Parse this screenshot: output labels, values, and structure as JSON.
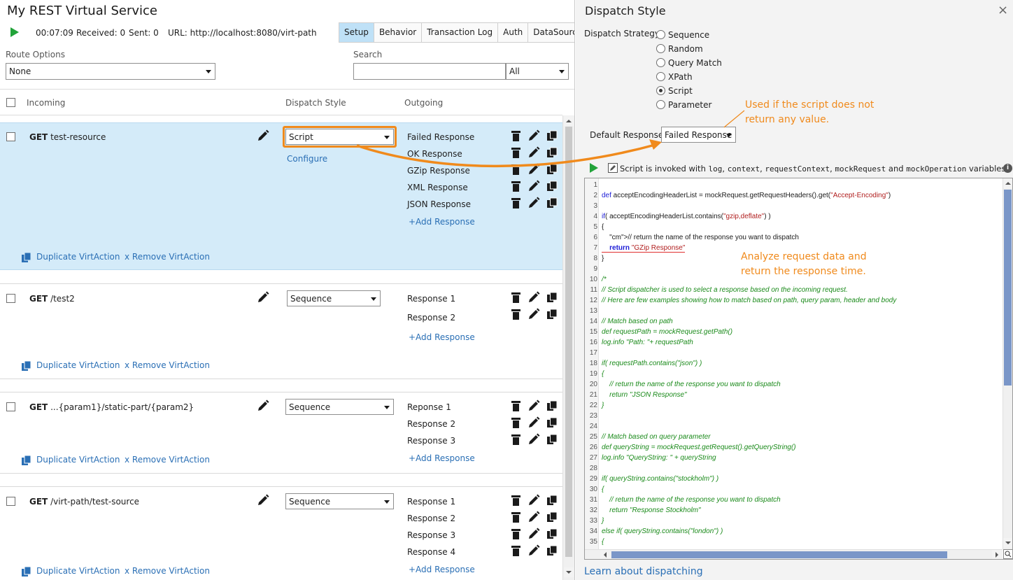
{
  "left": {
    "title": "My REST Virtual Service",
    "status": {
      "elapsed": "00:07:09",
      "received": "Received: 0",
      "sent": "Sent: 0",
      "url": "URL: http://localhost:8080/virt-path"
    },
    "tabs": [
      "Setup",
      "Behavior",
      "Transaction Log",
      "Auth",
      "DataSources"
    ],
    "active_tab": "Setup",
    "route_options_label": "Route Options",
    "route_options_value": "None",
    "search_label": "Search",
    "search_value": "",
    "search_filter": "All",
    "columns": {
      "incoming": "Incoming",
      "dispatch": "Dispatch Style",
      "outgoing": "Outgoing"
    },
    "routes": [
      {
        "method": "GET",
        "path": "test-resource",
        "dispatch": "Script",
        "configure": "Configure",
        "responses": [
          "Failed Response",
          "OK Response",
          "GZip Response",
          "XML Response",
          "JSON Response"
        ],
        "add_response": "+Add Response",
        "duplicate": "Duplicate VirtAction",
        "remove": "x Remove VirtAction"
      },
      {
        "method": "GET",
        "path": "/test2",
        "dispatch": "Sequence",
        "responses": [
          "Response 1",
          "Response 2"
        ],
        "add_response": "+Add Response",
        "duplicate": "Duplicate VirtAction",
        "remove": "x Remove VirtAction"
      },
      {
        "method": "GET",
        "path": "...{param1}/static-part/{param2}",
        "dispatch": "Sequence",
        "responses": [
          "Reponse 1",
          "Response 2",
          "Response 3"
        ],
        "add_response": "+Add Response",
        "duplicate": "Duplicate VirtAction",
        "remove": "x Remove VirtAction"
      },
      {
        "method": "GET",
        "path": "/virt-path/test-source",
        "dispatch": "Sequence",
        "responses": [
          "Response 1",
          "Response 2",
          "Response 3",
          "Response 4"
        ],
        "add_response": "+Add Response",
        "duplicate": "Duplicate VirtAction",
        "remove": "x Remove VirtAction"
      }
    ]
  },
  "right": {
    "title": "Dispatch Style",
    "close": "×",
    "strategy_label": "Dispatch Strategy:",
    "strategies": [
      "Sequence",
      "Random",
      "Query Match",
      "XPath",
      "Script",
      "Parameter"
    ],
    "selected_strategy": "Script",
    "default_response_label": "Default Response:",
    "default_response_value": "Failed Response",
    "annotation_default": [
      "Used if the script does not",
      "return any value."
    ],
    "annotation_analyze": [
      "Analyze request data and",
      "return the response time."
    ],
    "script_info": {
      "prefix": "Script is invoked with",
      "vars": [
        "log",
        "context",
        "requestContext",
        "mockRequest",
        "mockOperation"
      ],
      "and": "and",
      "suffix": "variables"
    },
    "learn_link": "Learn about dispatching",
    "code_lines": [
      "",
      "def acceptEncodingHeaderList = mockRequest.getRequestHeaders().get(\"Accept-Encoding\")",
      "",
      "if( acceptEncodingHeaderList.contains(\"gzip,deflate\") )",
      "{",
      "    // return the name of the response you want to dispatch",
      "    return \"GZip Response\"",
      "}",
      "",
      "/*",
      "// Script dispatcher is used to select a response based on the incoming request.",
      "// Here are few examples showing how to match based on path, query param, header and body",
      "",
      "// Match based on path",
      "def requestPath = mockRequest.getPath()",
      "log.info \"Path: \"+ requestPath",
      "",
      "if( requestPath.contains(\"json\") )",
      "{",
      "    // return the name of the response you want to dispatch",
      "    return \"JSON Response\"",
      "}",
      "",
      "",
      "// Match based on query parameter",
      "def queryString = mockRequest.getRequest().getQueryString()",
      "log.info \"QueryString: \" + queryString",
      "",
      "if( queryString.contains(\"stockholm\") )",
      "{",
      "    // return the name of the response you want to dispatch",
      "    return \"Response Stockholm\"",
      "}",
      "else if( queryString.contains(\"london\") )",
      "{"
    ]
  },
  "colors": {
    "accent": "#f08a1c",
    "selected_row": "#d4ebf9",
    "active_tab": "#bfe1f7",
    "play": "#22a33a",
    "link": "#2a6fb5"
  }
}
